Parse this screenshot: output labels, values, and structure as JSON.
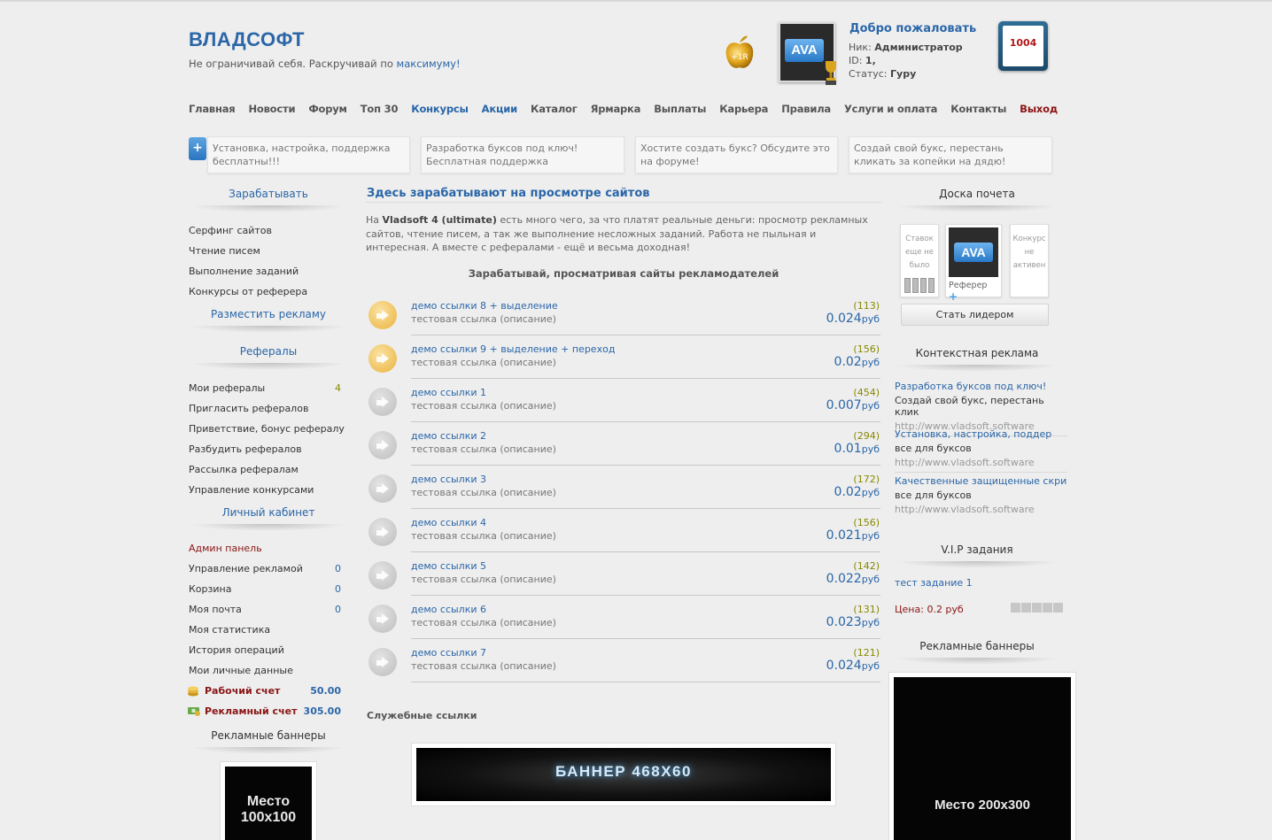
{
  "header": {
    "logo": "ВЛАДСОФТ",
    "slogan_prefix": "Не ограничивай себя. Раскручивай по",
    "slogan_link": "максимуму!",
    "apple_badge": "+1R",
    "avatar_label": "AVA",
    "welcome": "Добро пожаловать",
    "nick_label": "Ник:",
    "nick_value": "Администратор",
    "id_label": "ID:",
    "id_value": "1,",
    "status_label": "Статус:",
    "status_value": "Гуру",
    "counter": "1004"
  },
  "nav": [
    {
      "label": "Главная"
    },
    {
      "label": "Новости"
    },
    {
      "label": "Форум"
    },
    {
      "label": "Топ 30"
    },
    {
      "label": "Конкурсы"
    },
    {
      "label": "Акции"
    },
    {
      "label": "Каталог"
    },
    {
      "label": "Ярмарка"
    },
    {
      "label": "Выплаты"
    },
    {
      "label": "Карьера"
    },
    {
      "label": "Правила"
    },
    {
      "label": "Услуги и оплата"
    },
    {
      "label": "Контакты"
    },
    {
      "label": "Выход"
    }
  ],
  "info_boxes": [
    "Установка, настройка, поддержка бесплатны!!!",
    "Разработка буксов под ключ! Бесплатная поддержка",
    "Хостите создать букс? Обсудите это на форуме!",
    "Создай свой букс, перестань кликать за копейки на дядю!"
  ],
  "left": {
    "earn_heading": "Зарабатывать",
    "earn_items": [
      "Серфинг сайтов",
      "Чтение писем",
      "Выполнение заданий",
      "Конкурсы от реферера"
    ],
    "place_ad": "Разместить рекламу",
    "ref_heading": "Рефералы",
    "ref_items": [
      {
        "label": "Мои рефералы",
        "count": "4"
      },
      {
        "label": "Пригласить рефералов"
      },
      {
        "label": "Приветствие, бонус рефералу"
      },
      {
        "label": "Разбудить рефералов"
      },
      {
        "label": "Рассылка рефералам"
      },
      {
        "label": "Управление конкурсами"
      }
    ],
    "cabinet_heading": "Личный кабинет",
    "admin_panel": "Админ панель",
    "cab_items": [
      {
        "label": "Управление рекламой",
        "count": "0"
      },
      {
        "label": "Корзина",
        "count": "0"
      },
      {
        "label": "Моя почта",
        "count": "0"
      },
      {
        "label": "Моя статистика"
      },
      {
        "label": "История операций"
      },
      {
        "label": "Мои личные данные"
      }
    ],
    "work_account_label": "Рабочий счет",
    "work_account_value": "50.00",
    "ad_account_label": "Рекламный счет",
    "ad_account_value": "305.00",
    "banners_heading": "Рекламные баннеры",
    "banner_line1": "Место",
    "banner_line2": "100x100"
  },
  "center": {
    "title": "Здесь зарабатывают на просмотре сайтов",
    "intro_prefix": "На",
    "intro_brand": "Vladsoft 4 (ultimate)",
    "intro_text": "есть много чего, за что платят реальные деньги: просмотр рекламных сайтов, чтение писем, а так же выполнение несложных заданий. Работа не пыльная и интересная. А вместе с рефералами - ещё и весьма доходная!",
    "subtitle": "Зарабатывай, просматривая сайты рекламодателей",
    "currency": "руб",
    "links": [
      {
        "title": "демо ссылки 8 + выделение",
        "desc": "тестовая ссылка (описание)",
        "count": "(113)",
        "price": "0.024",
        "hl": true
      },
      {
        "title": "демо ссылки 9 + выделение + переход",
        "desc": "тестовая ссылка (описание)",
        "count": "(156)",
        "price": "0.02",
        "hl": true
      },
      {
        "title": "демо ссылки 1",
        "desc": "тестовая ссылка (описание)",
        "count": "(454)",
        "price": "0.007",
        "hl": false
      },
      {
        "title": "демо ссылки 2",
        "desc": "тестовая ссылка (описание)",
        "count": "(294)",
        "price": "0.01",
        "hl": false
      },
      {
        "title": "демо ссылки 3",
        "desc": "тестовая ссылка (описание)",
        "count": "(172)",
        "price": "0.02",
        "hl": false
      },
      {
        "title": "демо ссылки 4",
        "desc": "тестовая ссылка (описание)",
        "count": "(156)",
        "price": "0.021",
        "hl": false
      },
      {
        "title": "демо ссылки 5",
        "desc": "тестовая ссылка (описание)",
        "count": "(142)",
        "price": "0.022",
        "hl": false
      },
      {
        "title": "демо ссылки 6",
        "desc": "тестовая ссылка (описание)",
        "count": "(131)",
        "price": "0.023",
        "hl": false
      },
      {
        "title": "демо ссылки 7",
        "desc": "тестовая ссылка (описание)",
        "count": "(121)",
        "price": "0.024",
        "hl": false
      }
    ],
    "service_links": "Служебные ссылки",
    "banner468": "БАННЕР 468X60"
  },
  "right": {
    "honor_heading": "Доска почета",
    "honor_left": "Ставок еще не было",
    "honor_avatar": "AVA",
    "honor_ref": "Реферер",
    "honor_right": "Конкурс не активен",
    "leader_button": "Стать лидером",
    "ctx_heading": "Контекстная реклама",
    "ctx": [
      {
        "title": "Разработка буксов под ключ!",
        "desc": "Создай свой букс, перестань клик",
        "url": "http://www.vladsoft.software"
      },
      {
        "title": "Установка, настройка, поддер",
        "desc": "все для буксов",
        "url": "http://www.vladsoft.software"
      },
      {
        "title": "Качественные защищенные скри",
        "desc": "все для буксов",
        "url": "http://www.vladsoft.software"
      }
    ],
    "vip_heading": "V.I.P задания",
    "vip_task": "тест задание 1",
    "vip_price": "Цена: 0.2 руб",
    "banners_heading": "Рекламные баннеры",
    "banner": "Место 200x300"
  },
  "colors": {
    "accent": "#2a66a8",
    "dark_red": "#8b1515",
    "olive": "#888800"
  },
  "icons": [
    "golden-apple-icon",
    "trophy-icon",
    "plus-icon",
    "coins-icon",
    "money-icon",
    "link-arrow-icon"
  ]
}
